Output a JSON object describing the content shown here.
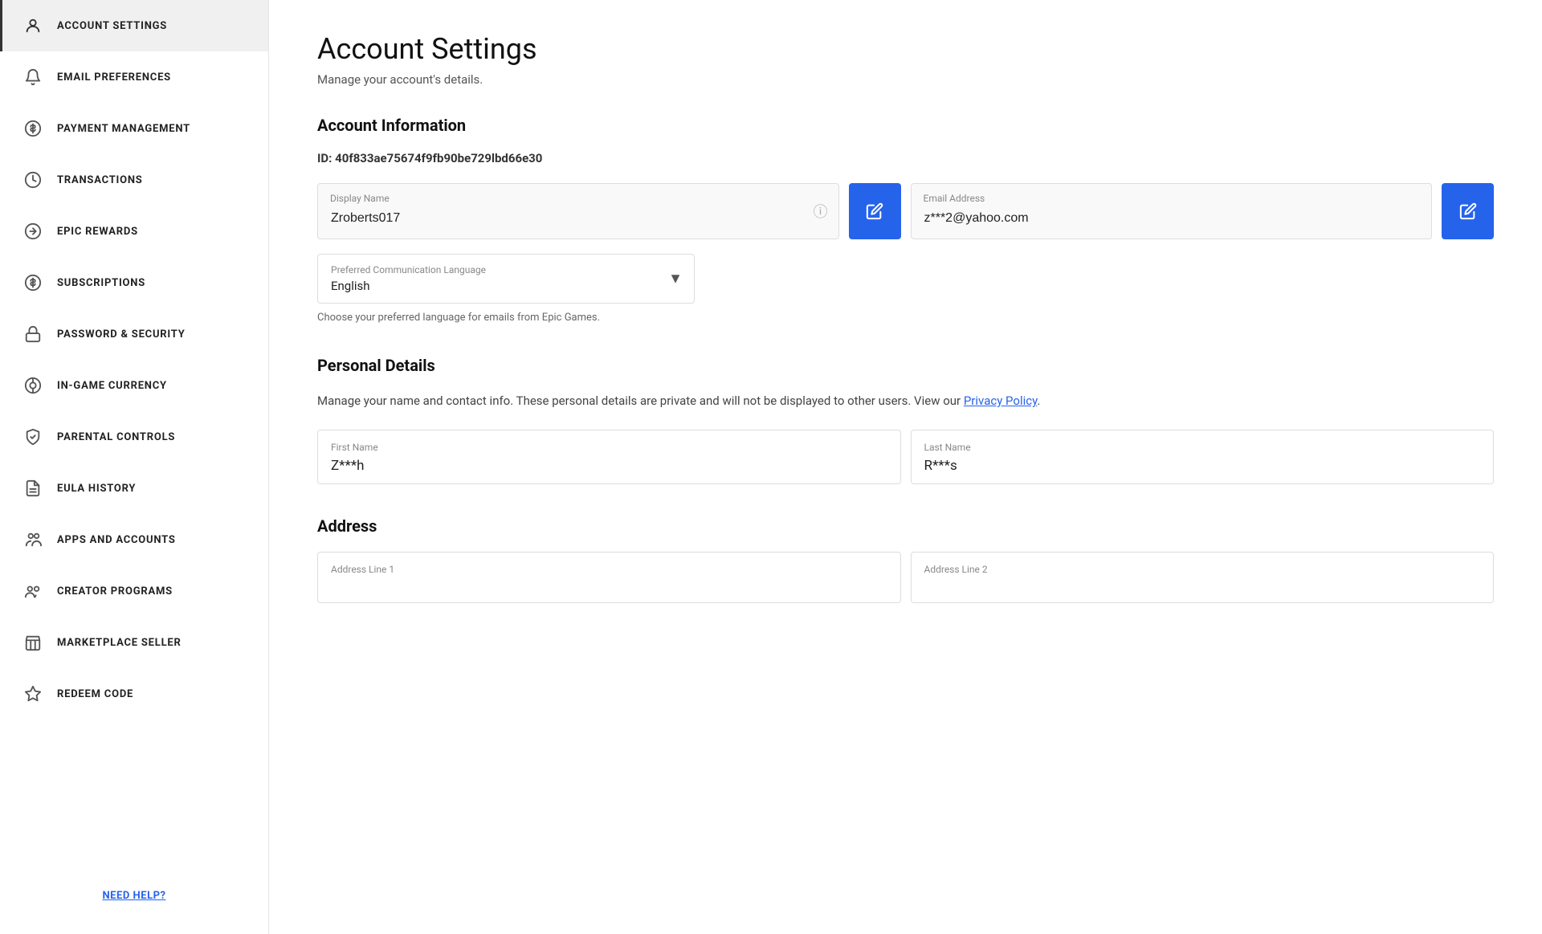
{
  "sidebar": {
    "items": [
      {
        "id": "account-settings",
        "label": "Account Settings",
        "icon": "person",
        "active": true
      },
      {
        "id": "email-preferences",
        "label": "Email Preferences",
        "icon": "bell",
        "active": false
      },
      {
        "id": "payment-management",
        "label": "Payment Management",
        "icon": "dollar",
        "active": false
      },
      {
        "id": "transactions",
        "label": "Transactions",
        "icon": "clock",
        "active": false
      },
      {
        "id": "epic-rewards",
        "label": "Epic Rewards",
        "icon": "arrow-circle",
        "active": false
      },
      {
        "id": "subscriptions",
        "label": "Subscriptions",
        "icon": "dollar-circle",
        "active": false
      },
      {
        "id": "password-security",
        "label": "Password & Security",
        "icon": "lock",
        "active": false
      },
      {
        "id": "in-game-currency",
        "label": "In-Game Currency",
        "icon": "dollar-circle2",
        "active": false
      },
      {
        "id": "parental-controls",
        "label": "Parental Controls",
        "icon": "shield",
        "active": false
      },
      {
        "id": "eula-history",
        "label": "EULA History",
        "icon": "doc",
        "active": false
      },
      {
        "id": "apps-and-accounts",
        "label": "Apps and Accounts",
        "icon": "users2",
        "active": false
      },
      {
        "id": "creator-programs",
        "label": "Creator Programs",
        "icon": "users",
        "active": false
      },
      {
        "id": "marketplace-seller",
        "label": "Marketplace Seller",
        "icon": "store",
        "active": false
      },
      {
        "id": "redeem-code",
        "label": "Redeem Code",
        "icon": "star",
        "active": false
      }
    ],
    "help_label": "NEED HELP?"
  },
  "main": {
    "page_title": "Account Settings",
    "page_subtitle": "Manage your account's details.",
    "account_info_title": "Account Information",
    "account_id_label": "ID:",
    "account_id_value": "40f833ae75674f9fb90be729lbd66e30",
    "display_name_label": "Display Name",
    "display_name_value": "Zroberts017",
    "email_label": "Email Address",
    "email_value": "z***2@yahoo.com",
    "language_label": "Preferred Communication Language",
    "language_value": "English",
    "language_hint": "Choose your preferred language for emails from Epic Games.",
    "personal_details_title": "Personal Details",
    "personal_details_intro": "Manage your name and contact info. These personal details are private and will not be displayed to other users. View our",
    "privacy_policy_label": "Privacy Policy",
    "first_name_label": "First Name",
    "first_name_value": "Z***h",
    "last_name_label": "Last Name",
    "last_name_value": "R***s",
    "address_title": "Address",
    "address_line1_label": "Address Line 1",
    "address_line2_label": "Address Line 2"
  }
}
